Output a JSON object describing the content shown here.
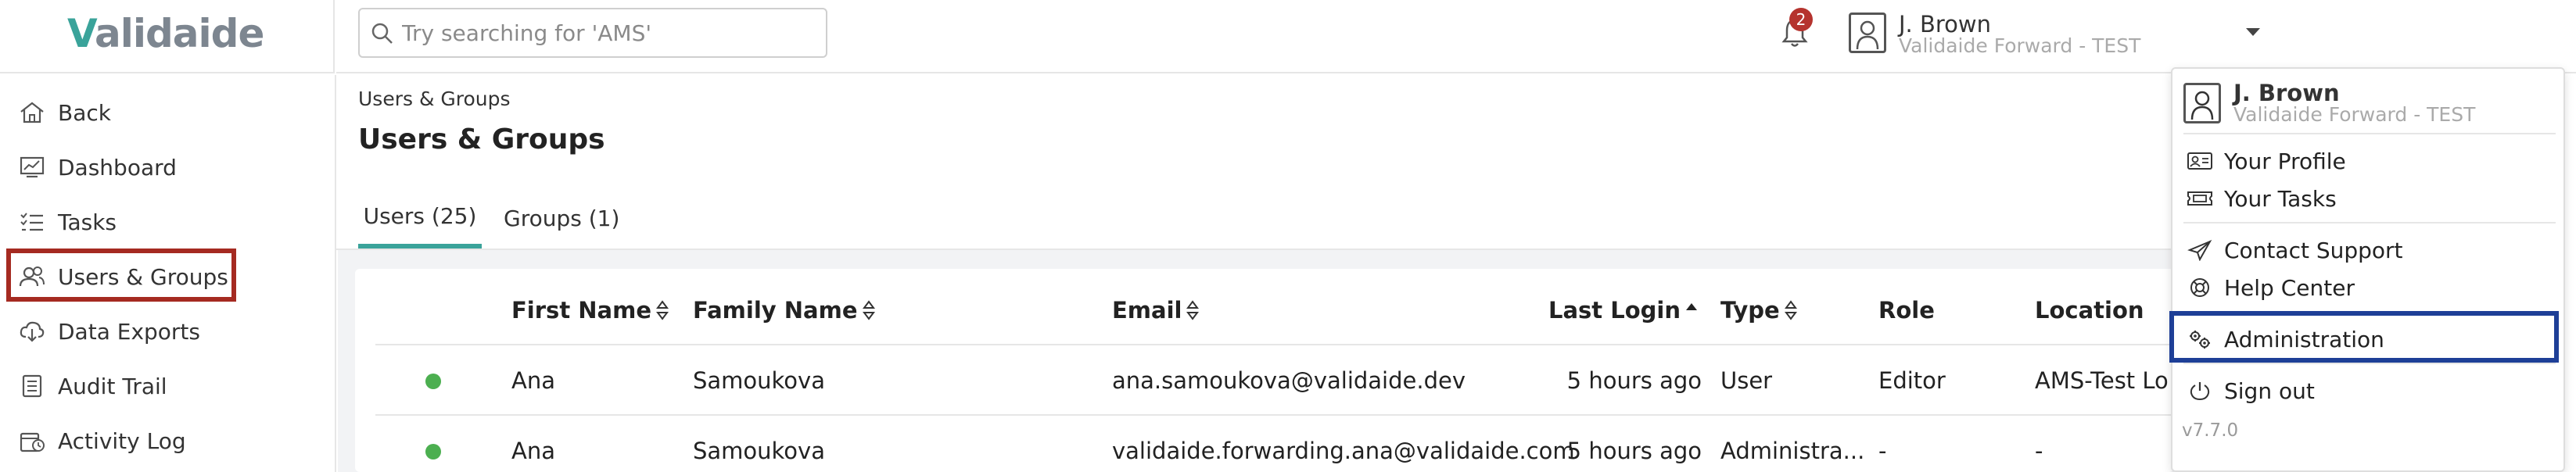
{
  "app": {
    "logo_v": "V",
    "logo_rest": "alidaide",
    "accent": "#3aa39a",
    "highlight_red": "#a52a21",
    "highlight_blue": "#1e3f97"
  },
  "search": {
    "placeholder": "Try searching for 'AMS'",
    "value": "",
    "icon": "search-icon"
  },
  "notifications": {
    "count": "2",
    "icon": "bell-icon"
  },
  "user": {
    "name": "J. Brown",
    "org": "Validaide Forward - TEST"
  },
  "sidebar": {
    "items": [
      {
        "label": "Back",
        "icon": "home-icon"
      },
      {
        "label": "Dashboard",
        "icon": "dashboard-icon"
      },
      {
        "label": "Tasks",
        "icon": "tasks-icon"
      },
      {
        "label": "Users & Groups",
        "icon": "users-icon"
      },
      {
        "label": "Data Exports",
        "icon": "download-icon"
      },
      {
        "label": "Audit Trail",
        "icon": "audit-icon"
      },
      {
        "label": "Activity Log",
        "icon": "activity-icon"
      }
    ]
  },
  "main": {
    "breadcrumb": "Users & Groups",
    "title": "Users & Groups",
    "tabs": [
      {
        "label": "Users (25)"
      },
      {
        "label": "Groups (1)"
      }
    ]
  },
  "table": {
    "columns": [
      "First Name",
      "Family Name",
      "Email",
      "Last Login",
      "Type",
      "Role",
      "Location"
    ],
    "rows": [
      {
        "status": "active",
        "first_name": "Ana",
        "family_name": "Samoukova",
        "email": "ana.samoukova@validaide.dev",
        "last_login": "5 hours ago",
        "type": "User",
        "role": "Editor",
        "location": "AMS-Test Loc"
      },
      {
        "status": "active",
        "first_name": "Ana",
        "family_name": "Samoukova",
        "email": "validaide.forwarding.ana@validaide.com",
        "last_login": "5 hours ago",
        "type": "Administra...",
        "role": "-",
        "location": "-"
      }
    ]
  },
  "menu": {
    "user_name": "J. Brown",
    "user_org": "Validaide Forward - TEST",
    "items": [
      {
        "label": "Your Profile",
        "icon": "id-card-icon"
      },
      {
        "label": "Your Tasks",
        "icon": "ticket-icon"
      },
      {
        "label": "Contact Support",
        "icon": "send-icon"
      },
      {
        "label": "Help Center",
        "icon": "lifebuoy-icon"
      },
      {
        "label": "Administration",
        "icon": "gears-icon"
      },
      {
        "label": "Sign out",
        "icon": "power-icon"
      }
    ],
    "version": "v7.7.0"
  }
}
